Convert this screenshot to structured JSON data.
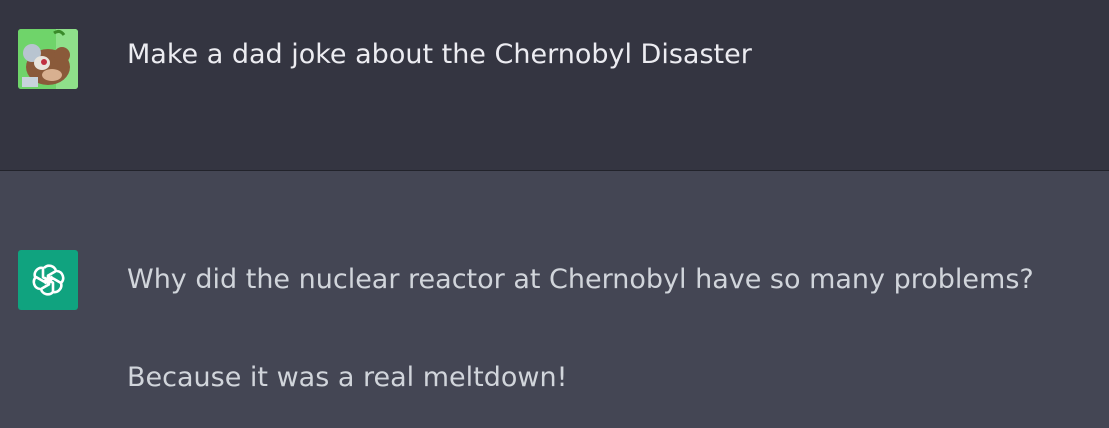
{
  "conversation": {
    "user_message": {
      "avatar_icon": "user-avatar-icon",
      "text": "Make a dad joke about the Chernobyl Disaster"
    },
    "assistant_message": {
      "avatar_icon": "openai-logo-icon",
      "paragraphs": [
        "Why did the nuclear reactor at Chernobyl have so many problems?",
        "Because it was a real meltdown!"
      ]
    }
  },
  "colors": {
    "user_bg": "#343541",
    "assistant_bg": "#444654",
    "assistant_avatar_bg": "#10a37f"
  }
}
